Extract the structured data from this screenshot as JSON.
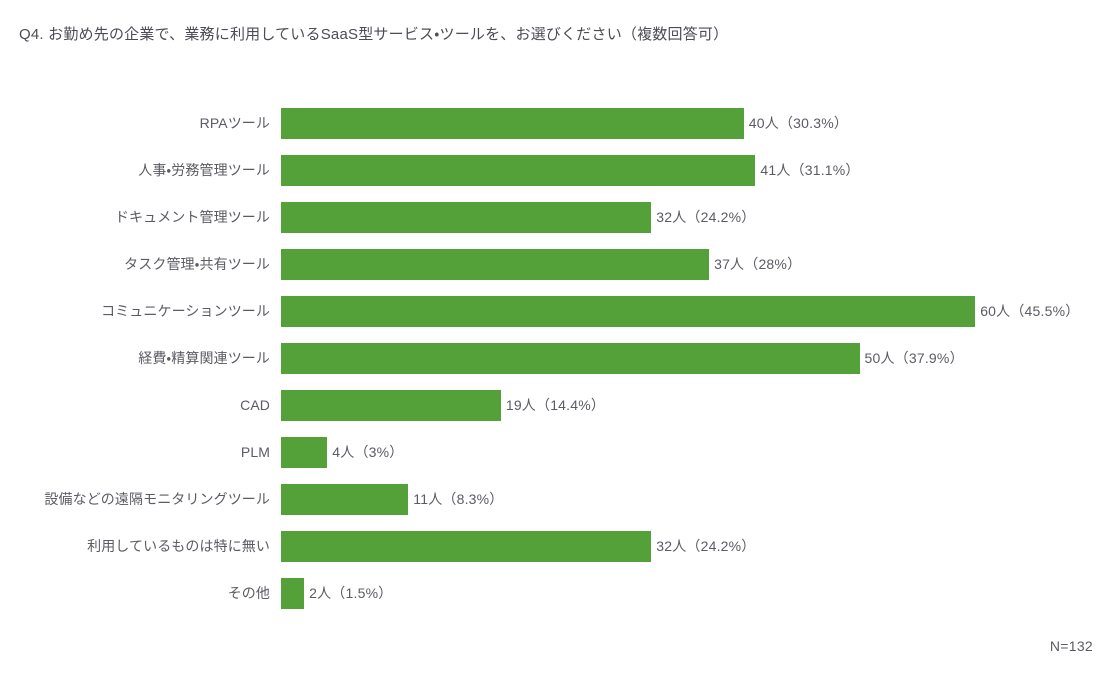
{
  "title": "Q4. お勤め先の企業で、業務に利用しているSaaS型サービス・ツールを、お選びください（複数回答可）",
  "sample_size_label": "N=132",
  "colors": {
    "bar": "#54a13a",
    "text": "#5b5b64",
    "title_text": "#4c4c55",
    "background": "#ffffff"
  },
  "chart_data": {
    "type": "bar",
    "orientation": "horizontal",
    "title": "Q4. お勤め先の企業で、業務に利用しているSaaS型サービス・ツールを、お選びください（複数回答可）",
    "xlabel": "",
    "ylabel": "",
    "xlim": [
      0,
      60
    ],
    "grid": false,
    "legend": false,
    "unit": "人",
    "total_responses": 132,
    "annotation": "N=132",
    "categories": [
      "RPAツール",
      "人事・労務管理ツール",
      "ドキュメント管理ツール",
      "タスク管理・共有ツール",
      "コミュニケーションツール",
      "経費・精算関連ツール",
      "CAD",
      "PLM",
      "設備などの遠隔モニタリングツール",
      "利用しているものは特に無い",
      "その他"
    ],
    "values": [
      40,
      41,
      32,
      37,
      60,
      50,
      19,
      4,
      11,
      32,
      2
    ],
    "percents": [
      30.3,
      31.1,
      24.2,
      28,
      45.5,
      37.9,
      14.4,
      3,
      8.3,
      24.2,
      1.5
    ],
    "data_labels": [
      "40人（30.3%）",
      "41人（31.1%）",
      "32人（24.2%）",
      "37人（28%）",
      "60人（45.5%）",
      "50人（37.9%）",
      "19人（14.4%）",
      "4人（3%）",
      "11人（8.3%）",
      "32人（24.2%）",
      "2人（1.5%）"
    ]
  }
}
